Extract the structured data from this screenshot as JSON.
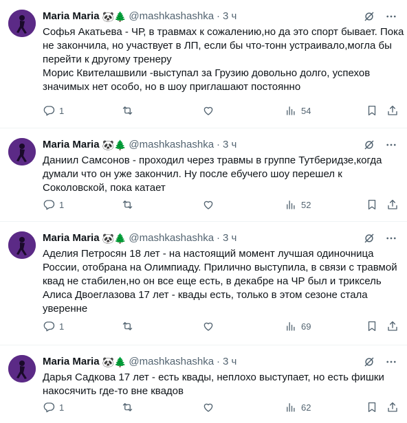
{
  "tweets": [
    {
      "author": "Maria Maria",
      "emoji": "🐼🌲",
      "handle": "@mashkashashka",
      "dot": "·",
      "time": "3 ч",
      "lines": [
        "Софья Акатьева - ЧР, в травмах к сожалению,но да это спорт бывает. Пока",
        "не закончила, но участвует в ЛП, если бы что-тонн устраивало,могла бы",
        "перейти к другому тренеру",
        "Морис Квителашвили -выступал за Грузию довольно долго, успехов",
        "значимых нет особо, но в шоу приглашают постоянно"
      ],
      "replies": "1",
      "retweets": "",
      "likes": "",
      "views": "54"
    },
    {
      "author": "Maria Maria",
      "emoji": "🐼🌲",
      "handle": "@mashkashashka",
      "dot": "·",
      "time": "3 ч",
      "lines": [
        "Даниил Самсонов - проходил через травмы в группе Тутберидзе,когда",
        "думали что он уже закончил. Ну после ебучего шоу перешел к",
        "Соколовской, пока катает"
      ],
      "replies": "1",
      "retweets": "",
      "likes": "",
      "views": "52"
    },
    {
      "author": "Maria Maria",
      "emoji": "🐼🌲",
      "handle": "@mashkashashka",
      "dot": "·",
      "time": "3 ч",
      "lines": [
        "Аделия Петросян 18 лет - на настоящий момент лучшая одиночница",
        "России, отобрана на Олимпиаду. Прилично выступила, в связи с травмой",
        "квад не стабилен,но он все еще есть, в декабре на ЧР был и триксель",
        "Алиса Двоеглазова  17 лет - квады есть, только в этом сезоне стала",
        "уверенне"
      ],
      "replies": "1",
      "retweets": "",
      "likes": "",
      "views": "69"
    },
    {
      "author": "Maria Maria",
      "emoji": "🐼🌲",
      "handle": "@mashkashashka",
      "dot": "·",
      "time": "3 ч",
      "lines": [
        "Дарья Садкова 17 лет - есть квады, неплохо выступает, но есть фишки",
        "накосячить где-то вне квадов"
      ],
      "replies": "1",
      "retweets": "",
      "likes": "",
      "views": "62"
    }
  ],
  "icons": {
    "grok": "grok-icon",
    "more": "more-icon",
    "reply": "reply-icon",
    "retweet": "retweet-icon",
    "like": "like-icon",
    "views": "views-icon",
    "bookmark": "bookmark-icon",
    "share": "share-icon"
  },
  "colors": {
    "text": "#0f1419",
    "secondary": "#536471",
    "divider": "#eff3f4",
    "avatar_bg": "#5b2a86"
  }
}
